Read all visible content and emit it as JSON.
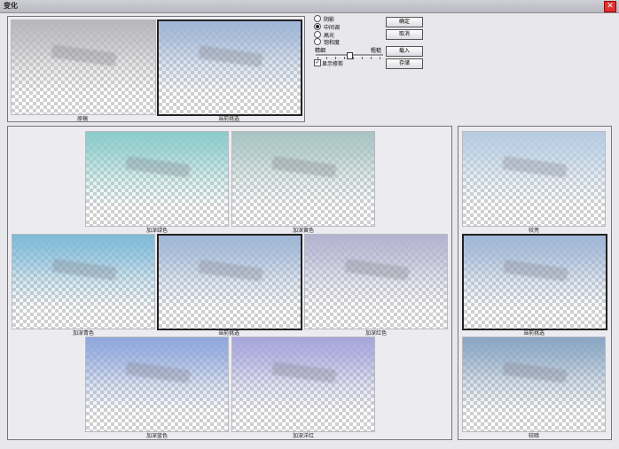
{
  "window": {
    "title": "变化",
    "close_glyph": "✕"
  },
  "top": {
    "original_label": "原稿",
    "current_label": "当前挑选"
  },
  "options": {
    "radios": [
      {
        "label": "阴影",
        "selected": false
      },
      {
        "label": "中间调",
        "selected": true
      },
      {
        "label": "高光",
        "selected": false
      },
      {
        "label": "饱和度",
        "selected": false
      }
    ],
    "fine_label": "精细",
    "coarse_label": "粗糙",
    "slider_level": 0.5,
    "show_clipping_label": "显示修剪",
    "show_clipping_checked": true,
    "check_glyph": "✓"
  },
  "buttons": {
    "ok": "确定",
    "cancel": "取消",
    "load": "载入",
    "save": "存储"
  },
  "color_grid": {
    "more_green": "加深绿色",
    "more_yellow": "加深黄色",
    "more_cyan": "加深青色",
    "current": "当前挑选",
    "more_red": "加深红色",
    "more_blue": "加深蓝色",
    "more_magenta": "加深洋红"
  },
  "brightness": {
    "lighter": "较亮",
    "current": "当前挑选",
    "darker": "较暗"
  },
  "colors": {
    "original_tint": "#b8b8bc",
    "current_tint": "#9fb6d6",
    "green_tint": "#8ccccc",
    "yellow_tint": "#a9c4c4",
    "cyan_tint": "#7fbad8",
    "red_tint": "#b3b3d0",
    "blue_tint": "#8ea7dc",
    "magenta_tint": "#a6a6dc",
    "lighter_tint": "#b6cce2",
    "darker_tint": "#8aa6c4"
  }
}
